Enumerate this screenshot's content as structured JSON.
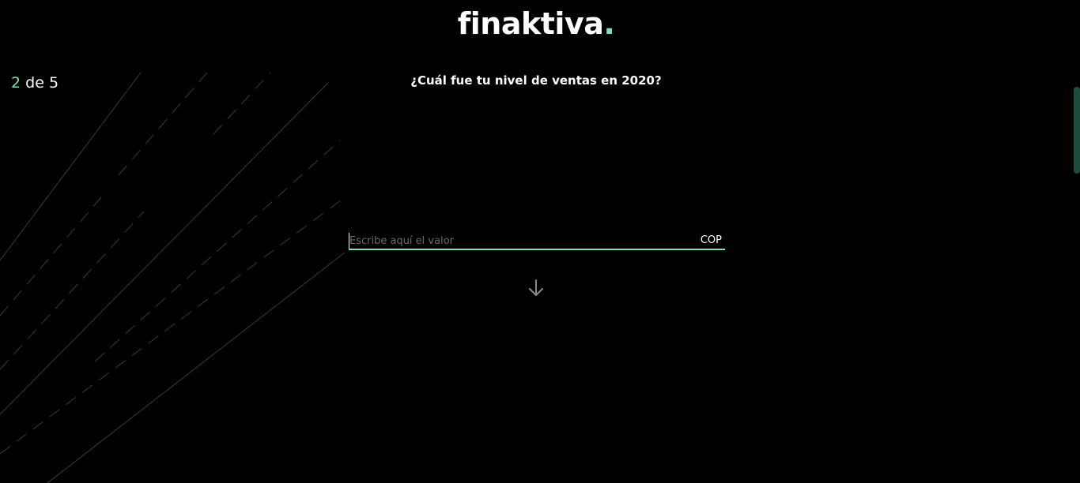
{
  "logo": {
    "text": "finaktiva",
    "dot": "."
  },
  "progress": {
    "current": "2",
    "separator": "de",
    "total": "5"
  },
  "question": {
    "text": "¿Cuál fue tu nivel de ventas en 2020?"
  },
  "sales_input": {
    "placeholder": "Escribe aquí el valor",
    "value": "",
    "currency": "COP"
  },
  "next": {
    "icon": "arrow-down-icon"
  },
  "colors": {
    "accent": "#7ee2b8",
    "background": "#000000",
    "text": "#ffffff",
    "placeholder": "#6a6a6a"
  }
}
